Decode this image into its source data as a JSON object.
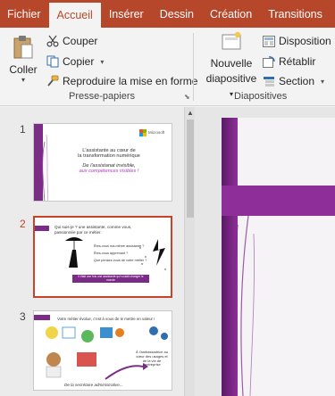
{
  "tabs": [
    "Fichier",
    "Accueil",
    "Insérer",
    "Dessin",
    "Création",
    "Transitions"
  ],
  "clipboard": {
    "paste_label": "Coller",
    "cut_label": "Couper",
    "copy_label": "Copier",
    "format_painter_label": "Reproduire la mise en forme",
    "group_label": "Presse-papiers"
  },
  "slides_group": {
    "new_slide_line1": "Nouvelle",
    "new_slide_line2": "diapositive",
    "layout_label": "Disposition",
    "reset_label": "Rétablir",
    "section_label": "Section",
    "group_label": "Diapositives"
  },
  "thumbnails": [
    {
      "number": "1",
      "microsoft": "Microsoft",
      "line1": "L'assistante au cœur de",
      "line2": "la transformation numérique",
      "line3": "De l'assistanat invisible,",
      "line4": "aux compétences visibles !"
    },
    {
      "number": "2",
      "title": "Qui suis-je ? une assistante, comme vous, passionnée par ce métier.",
      "q1": "Êtes-vous ma-même assistante ?",
      "q2": "Êtes-vous apprenant ?",
      "q3": "Que pensez-vous de votre métier ?",
      "banner": "Il était une fois une assistante qui voulait changer le monde"
    },
    {
      "number": "3",
      "title": "Votre métier évolue, c'est à vous de le mettre en valeur !",
      "side_text": "À l'ambassadrice au cœur des usages et de la vie de l'entreprise",
      "bottom_text": "De la secrétaire administrative..."
    }
  ],
  "colors": {
    "brand_red": "#b7472a",
    "purple": "#8e2e99",
    "dark_purple": "#5a1a66"
  }
}
